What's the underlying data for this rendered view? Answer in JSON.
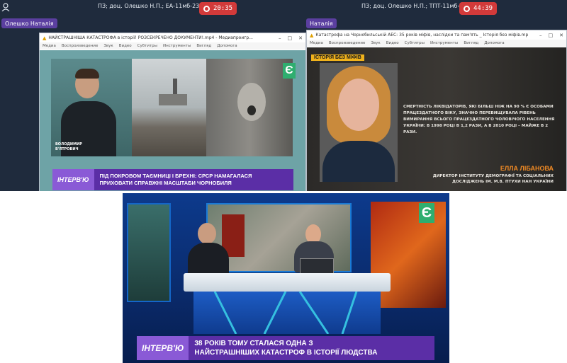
{
  "topbar": {
    "user_icon": "person-icon",
    "left_meeting_title": "ПЗ; доц. Олешко Н.П.; ЕА-11мб-23",
    "left_timer": "20:35",
    "right_meeting_title": "ПЗ; доц. Олешко Н.П.; ТПТ-11мб-23",
    "right_timer": "44:39",
    "participant_name_left": "Олешко Наталія",
    "participant_name_right": "Наталія"
  },
  "left_window": {
    "title": "НАЙСТРАШНІША КАТАСТРОФА в історії! РОЗСЕКРЕЧЕНО ДОКУМЕНТИ!.mp4 - Медиапроигр...",
    "menu": [
      "Медиа",
      "Воспроизведение",
      "Звук",
      "Видео",
      "Субтитры",
      "Инструменты",
      "Вигляд",
      "Допомога"
    ],
    "speaker_name_line1": "ВОЛОДИМИР",
    "speaker_name_line2": "В'ЯТРОВИЧ",
    "logo": "Є",
    "banner_tag": "ІНТЕРВ'Ю",
    "banner_line1": "ПІД ПОКРОВОМ ТАЄМНИЦІ І БРЕХНІ: СРСР НАМАГАЛАСЯ",
    "banner_line2": "ПРИХОВАТИ СПРАВЖНІ МАСШТАБИ ЧОРНОБИЛЯ"
  },
  "right_window": {
    "title": "Катастрофа на Чорнобильській АЕС: 35 років міфів, наслідки та пам'ять _ Історія без міфів.mp4 - М...",
    "menu": [
      "Медиа",
      "Воспроизведение",
      "Звук",
      "Видео",
      "Субтитры",
      "Инструменты",
      "Вигляд",
      "Допомога"
    ],
    "show_label": "ІСТОРІЯ БЕЗ МІФІВ",
    "quote": "СМЕРТНІСТЬ ЛІКВІДАТОРІВ, ЯКІ БІЛЬШ НІЖ НА 90 % Є ОСОБАМИ ПРАЦЕЗДАТНОГО ВІКУ, ЗНАЧНО ПЕРЕВИЩУВАЛА РІВЕНЬ ВИМИРАННЯ ВСЬОГО ПРАЦЕЗДАТНОГО ЧОЛОВІЧОГО НАСЕЛЕННЯ УКРАЇНИ: В 1998 РОЦІ В 1,2 РАЗИ, А В 2010 РОЦІ – МАЙЖЕ В 2 РАЗИ.",
    "person_name": "ЕЛЛА ЛІБАНОВА",
    "person_role_line1": "ДИРЕКТОР ІНСТИТУТУ ДЕМОГРАФІЇ ТА СОЦІАЛЬНИХ",
    "person_role_line2": "ДОСЛІДЖЕНЬ ІМ. М.В. ПТУХИ НАН УКРАЇНИ"
  },
  "bottom_video": {
    "logo": "Є",
    "banner_tag": "ІНТЕРВ'Ю",
    "banner_line1": "38 РОКІВ ТОМУ СТАЛАСЯ ОДНА З",
    "banner_line2": "НАЙСТРАШНІШИХ КАТАСТРОФ В ІСТОРІЇ ЛЮДСТВА"
  },
  "colors": {
    "teams_bg": "#1f2b3d",
    "record_red": "#d23a3a",
    "espreso_green": "#2fae6f",
    "banner_purple": "#5b2ea6",
    "tag_purple": "#8a5ad6",
    "studio_blue": "#0b2c73",
    "name_orange": "#f08a24"
  }
}
